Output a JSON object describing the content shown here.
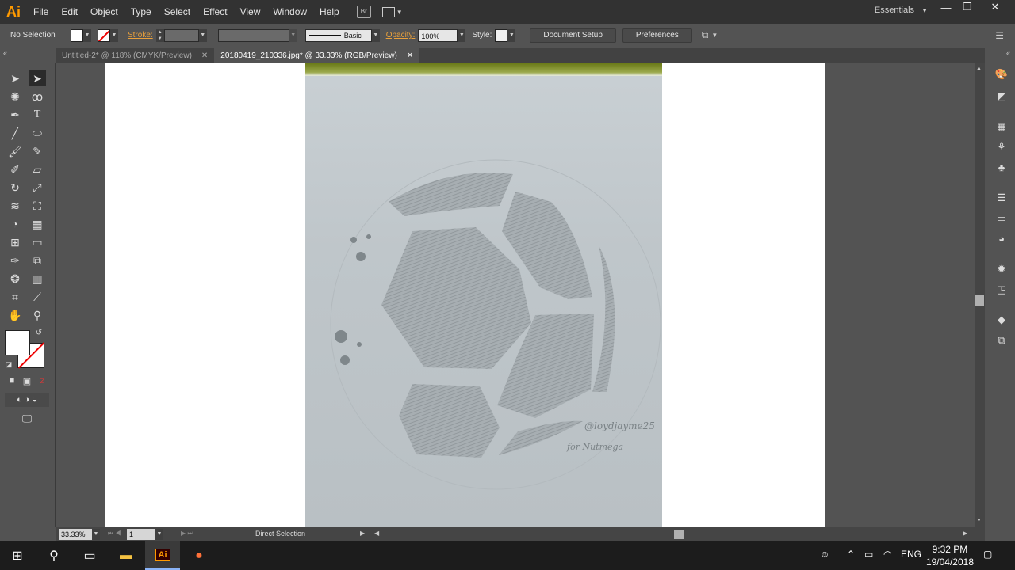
{
  "app": {
    "logo": "Ai"
  },
  "menu": [
    "File",
    "Edit",
    "Object",
    "Type",
    "Select",
    "Effect",
    "View",
    "Window",
    "Help"
  ],
  "bridge_label": "Br",
  "workspace": "Essentials",
  "window_controls": {
    "minimize": "—",
    "restore": "❐",
    "close": "✕"
  },
  "control_bar": {
    "selection": "No Selection",
    "stroke_label": "Stroke:",
    "brush": "Basic",
    "opacity_label": "Opacity:",
    "opacity_value": "100%",
    "style_label": "Style:",
    "document_setup": "Document Setup",
    "preferences": "Preferences"
  },
  "tabs": [
    {
      "label": "Untitled-2* @ 118% (CMYK/Preview)",
      "close": "✕"
    },
    {
      "label": "20180419_210336.jpg* @ 33.33% (RGB/Preview)",
      "close": "✕"
    }
  ],
  "tools": [
    "selection-tool-icon",
    "direct-selection-tool-icon",
    "magic-wand-tool-icon",
    "lasso-tool-icon",
    "pen-tool-icon",
    "type-tool-icon",
    "line-tool-icon",
    "ellipse-tool-icon",
    "paintbrush-tool-icon",
    "pencil-tool-icon",
    "blob-brush-tool-icon",
    "eraser-tool-icon",
    "rotate-tool-icon",
    "scale-tool-icon",
    "warp-tool-icon",
    "free-transform-tool-icon",
    "shape-builder-tool-icon",
    "perspective-grid-tool-icon",
    "mesh-tool-icon",
    "gradient-tool-icon",
    "eyedropper-tool-icon",
    "blend-tool-icon",
    "symbol-sprayer-tool-icon",
    "column-graph-tool-icon",
    "artboard-tool-icon",
    "slice-tool-icon",
    "hand-tool-icon",
    "zoom-tool-icon"
  ],
  "artwork": {
    "signature": "@loydjayme25",
    "dedication": "for Nutmega"
  },
  "status": {
    "zoom": "33.33%",
    "page": "1",
    "tool": "Direct Selection"
  },
  "taskbar": {
    "language": "ENG",
    "time": "9:32 PM",
    "date": "19/04/2018"
  }
}
